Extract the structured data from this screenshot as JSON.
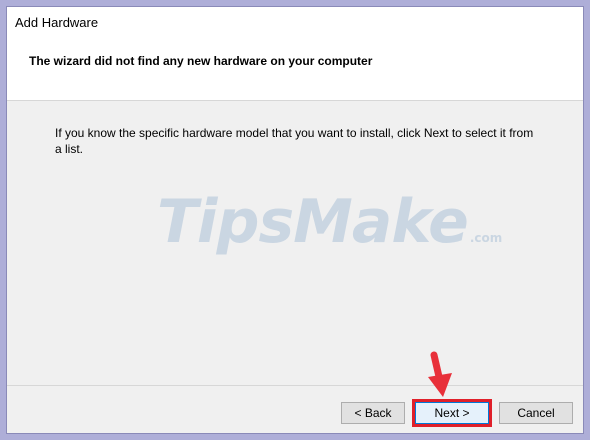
{
  "window": {
    "title": "Add Hardware",
    "header": "The wizard did not find any new hardware on your computer"
  },
  "body": {
    "text": "If you know the specific hardware model that you want to install, click Next to select it from a list."
  },
  "watermark": {
    "brand": "TipsMake",
    "suffix": ".com"
  },
  "buttons": {
    "back": "< Back",
    "next": "Next >",
    "cancel": "Cancel"
  },
  "annotation": {
    "arrow_icon": "red-pointer-arrow-icon",
    "highlight_color": "#e0202a"
  }
}
